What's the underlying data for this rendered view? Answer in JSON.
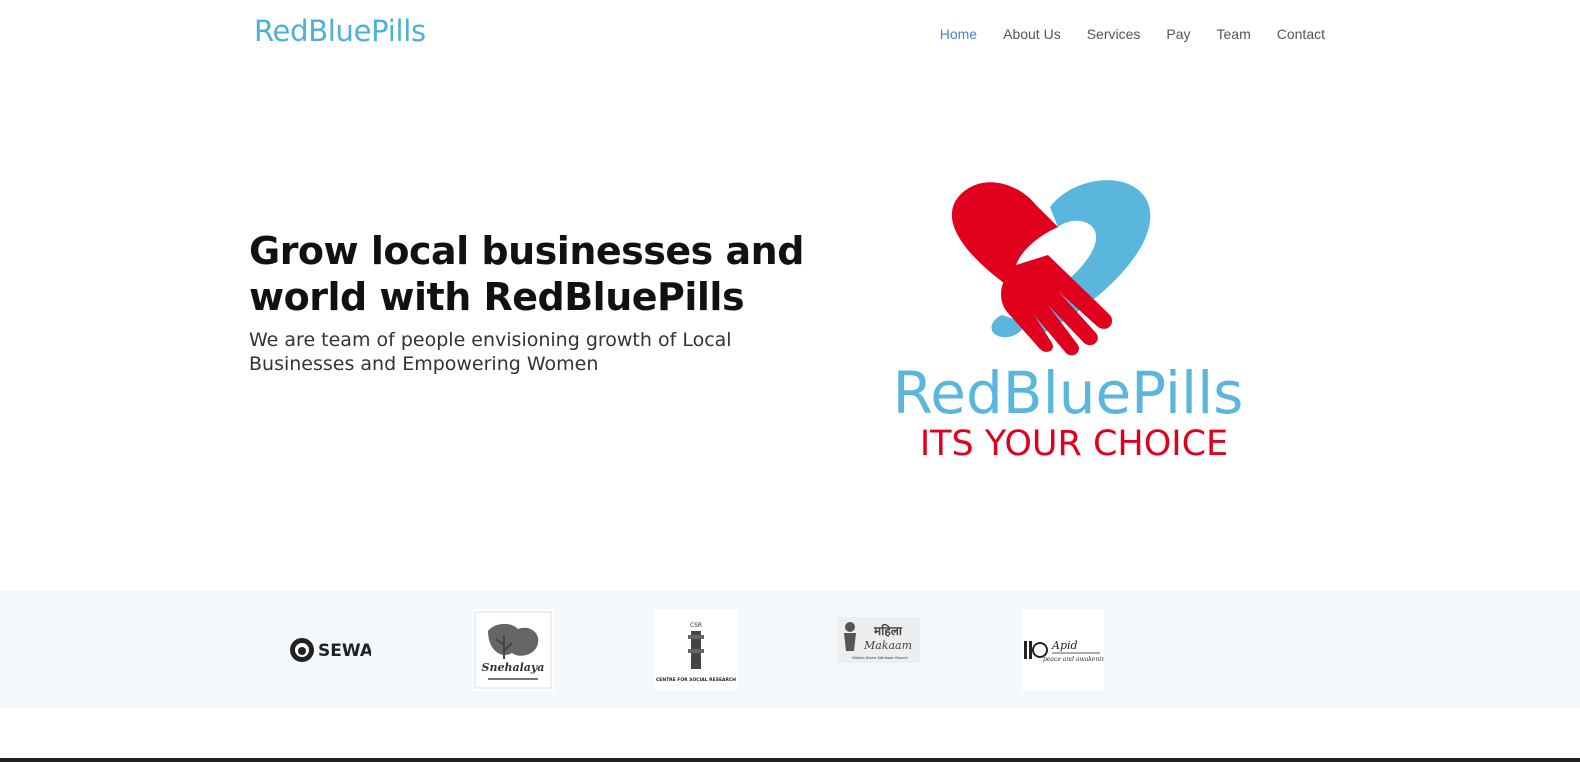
{
  "brand": {
    "name": "RedBluePills"
  },
  "nav": {
    "items": [
      {
        "label": "Home",
        "active": true
      },
      {
        "label": "About Us"
      },
      {
        "label": "Services"
      },
      {
        "label": "Pay"
      },
      {
        "label": "Team"
      },
      {
        "label": "Contact"
      }
    ]
  },
  "hero": {
    "title": "Grow local businesses and world with RedBluePills",
    "subtitle": "We are team of people envisioning growth of Local Businesses and Empowering Women",
    "logo_text": "RedBluePills",
    "logo_tagline": "ITS YOUR CHOICE"
  },
  "partners": [
    {
      "name": "SEWA"
    },
    {
      "name": "Snehalaya"
    },
    {
      "name": "CENTRE FOR SOCIAL RESEARCH"
    },
    {
      "name": "Mahila Kisan Adhikaar Manch"
    },
    {
      "name": "Apid"
    }
  ],
  "colors": {
    "brand_blue": "#4eb0d9",
    "brand_red": "#e0001e",
    "nav_active": "#4c7fd6",
    "partners_bg": "#f3f8fc"
  }
}
